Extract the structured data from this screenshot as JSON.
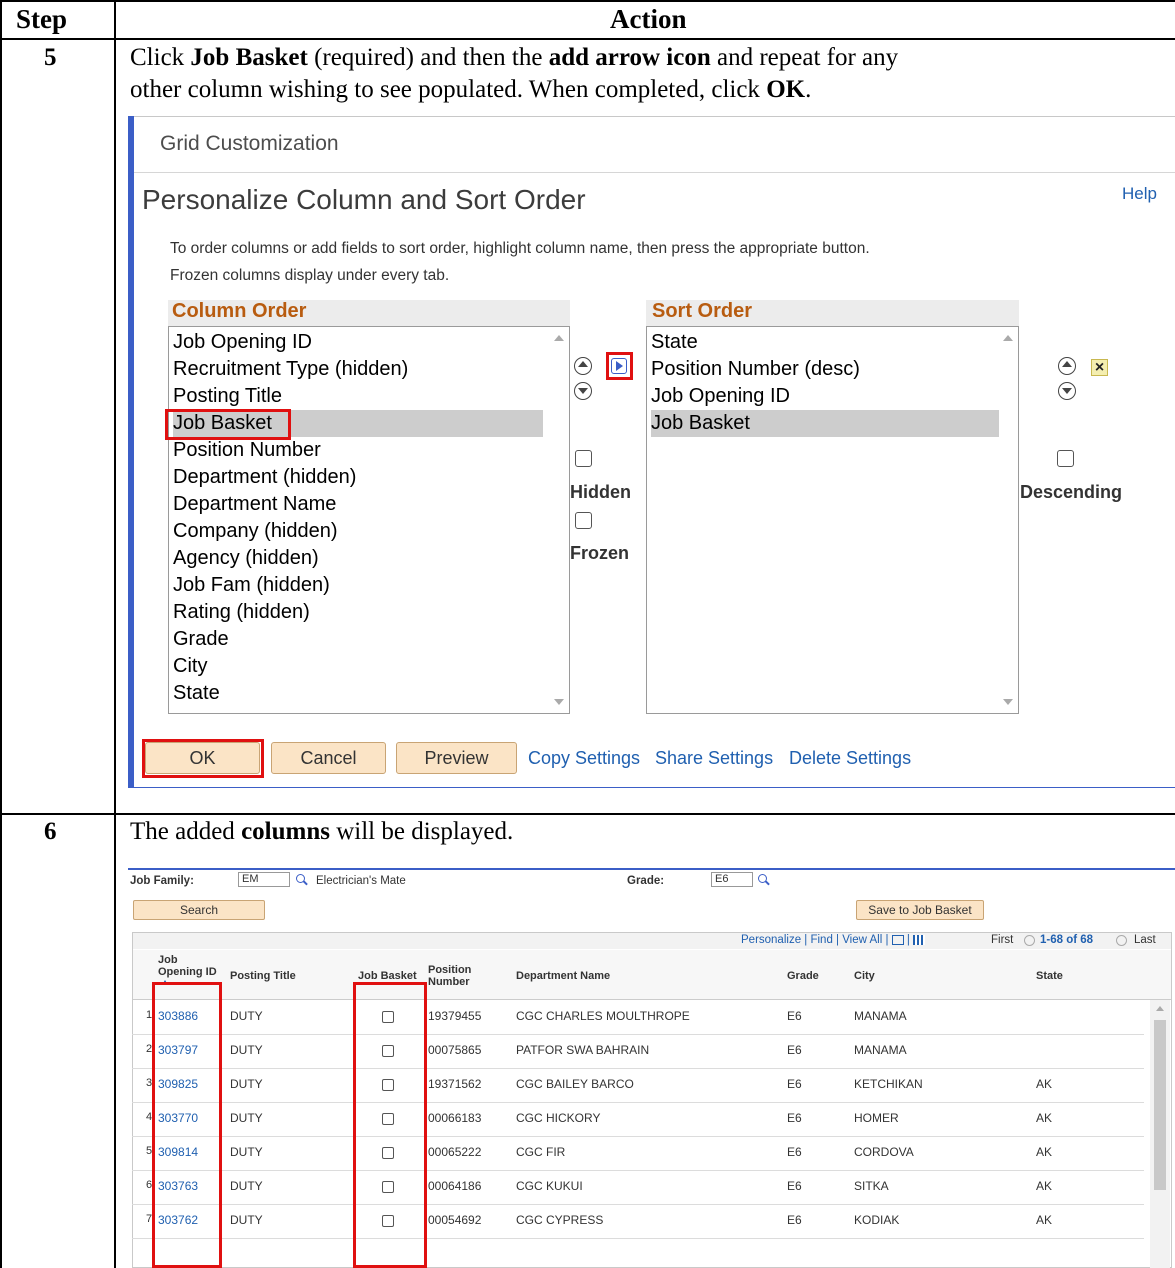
{
  "table": {
    "header_step": "Step",
    "header_action": "Action"
  },
  "step5": {
    "number": "5",
    "line1_pre": "Click ",
    "line1_b1": "Job Basket",
    "line1_mid": " (required) and then the ",
    "line1_b2": "add arrow icon",
    "line1_post": " and repeat for any",
    "line2_pre": "other column wishing to see populated. When completed, click ",
    "line2_b": "OK",
    "line2_post": "."
  },
  "grid_customization": {
    "title": "Grid Customization",
    "heading": "Personalize Column and Sort Order",
    "help": "Help",
    "desc1": "To order columns or add fields to sort order, highlight column name, then press the appropriate button.",
    "desc2": "Frozen columns display under every tab.",
    "column_order_label": "Column Order",
    "column_order": [
      "Job Opening ID",
      "Recruitment Type (hidden)",
      "Posting Title",
      "Job Basket",
      "Position Number",
      "Department (hidden)",
      "Department Name",
      "Company (hidden)",
      "Agency (hidden)",
      "Job Fam (hidden)",
      "Rating (hidden)",
      "Grade",
      "City",
      "State"
    ],
    "sort_order_label": "Sort Order",
    "sort_order": [
      "State",
      "Position Number (desc)",
      "Job Opening ID",
      "Job Basket"
    ],
    "hidden_label": "Hidden",
    "frozen_label": "Frozen",
    "descending_label": "Descending",
    "remove_glyph": "×",
    "ok": "OK",
    "cancel": "Cancel",
    "preview": "Preview",
    "copy_settings": "Copy Settings",
    "share_settings": "Share Settings",
    "delete_settings": "Delete Settings",
    "accent": "#e01010"
  },
  "step6": {
    "number": "6",
    "pre": "The added ",
    "bold": "columns",
    "post": " will be displayed."
  },
  "job_search": {
    "job_family_label": "Job Family:",
    "job_family_value": "EM",
    "job_family_desc": "Electrician's Mate",
    "grade_label": "Grade:",
    "grade_value": "E6",
    "search": "Search",
    "save_basket": "Save to Job Basket",
    "nav": "Personalize | Find | View All | ",
    "nav_first": "First",
    "nav_range": "1-68 of 68",
    "nav_last": "Last",
    "columns": {
      "job_opening_id": "Job Opening ID",
      "posting_title": "Posting Title",
      "job_basket": "Job Basket",
      "position_number": "Position Number",
      "department_name": "Department Name",
      "grade": "Grade",
      "city": "City",
      "state": "State"
    },
    "rows": [
      {
        "n": "1",
        "id": "303886",
        "title": "DUTY",
        "pos": "19379455",
        "dept": "CGC CHARLES MOULTHROPE",
        "grade": "E6",
        "city": "MANAMA",
        "state": ""
      },
      {
        "n": "2",
        "id": "303797",
        "title": "DUTY",
        "pos": "00075865",
        "dept": "PATFOR SWA BAHRAIN",
        "grade": "E6",
        "city": "MANAMA",
        "state": ""
      },
      {
        "n": "3",
        "id": "309825",
        "title": "DUTY",
        "pos": "19371562",
        "dept": "CGC BAILEY BARCO",
        "grade": "E6",
        "city": "KETCHIKAN",
        "state": "AK"
      },
      {
        "n": "4",
        "id": "303770",
        "title": "DUTY",
        "pos": "00066183",
        "dept": "CGC HICKORY",
        "grade": "E6",
        "city": "HOMER",
        "state": "AK"
      },
      {
        "n": "5",
        "id": "309814",
        "title": "DUTY",
        "pos": "00065222",
        "dept": "CGC FIR",
        "grade": "E6",
        "city": "CORDOVA",
        "state": "AK"
      },
      {
        "n": "6",
        "id": "303763",
        "title": "DUTY",
        "pos": "00064186",
        "dept": "CGC KUKUI",
        "grade": "E6",
        "city": "SITKA",
        "state": "AK"
      },
      {
        "n": "7",
        "id": "303762",
        "title": "DUTY",
        "pos": "00054692",
        "dept": "CGC CYPRESS",
        "grade": "E6",
        "city": "KODIAK",
        "state": "AK"
      }
    ]
  }
}
